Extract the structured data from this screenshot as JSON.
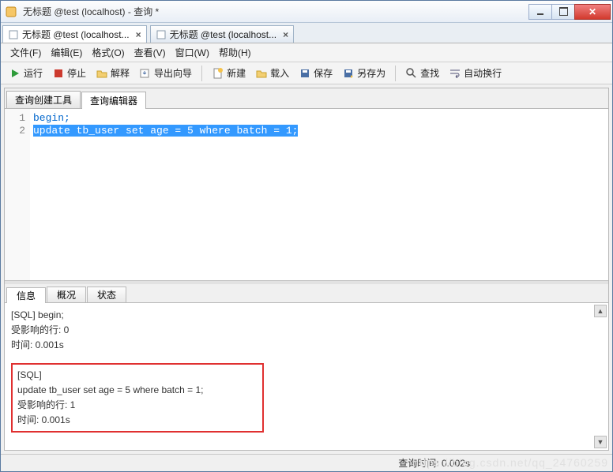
{
  "titlebar": {
    "title": "无标题 @test (localhost) - 查询 *"
  },
  "doctabs": [
    {
      "label": "无标题 @test (localhost...",
      "active": true
    },
    {
      "label": "无标题 @test (localhost...",
      "active": false
    }
  ],
  "menu": {
    "file": "文件(F)",
    "edit": "编辑(E)",
    "format": "格式(O)",
    "view": "查看(V)",
    "window": "窗口(W)",
    "help": "帮助(H)"
  },
  "toolbar": {
    "run": "运行",
    "stop": "停止",
    "explain": "解释",
    "export": "导出向导",
    "new": "新建",
    "load": "载入",
    "save": "保存",
    "saveas": "另存为",
    "find": "查找",
    "autowrap": "自动换行"
  },
  "innerTabs": {
    "builder": "查询创建工具",
    "editor": "查询编辑器"
  },
  "code": {
    "lines": [
      "1",
      "2"
    ],
    "l1": "begin;",
    "l2": "update tb_user set age = 5 where batch = 1;"
  },
  "outtabs": {
    "info": "信息",
    "profile": "概况",
    "status": "状态"
  },
  "output": {
    "block1": {
      "sql": "[SQL] begin;",
      "rows": "受影响的行: 0",
      "time": "时间: 0.001s"
    },
    "block2": {
      "sqltag": "[SQL]",
      "stmt": "update tb_user set age = 5 where batch = 1;",
      "rows": "受影响的行: 1",
      "time": "时间: 0.001s"
    }
  },
  "status": {
    "querytime": "查询时间: 0.002s"
  },
  "watermark": "https://blog.csdn.net/qq_24760259"
}
